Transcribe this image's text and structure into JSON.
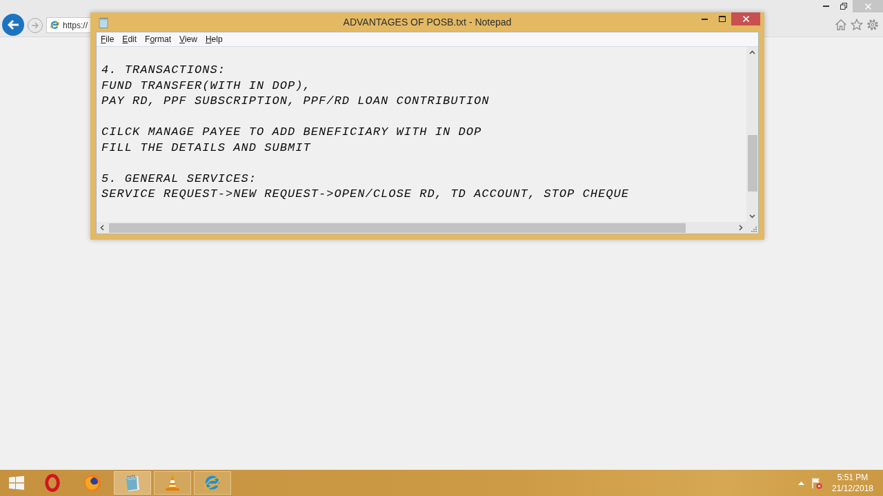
{
  "browser": {
    "address": "https://"
  },
  "notepad": {
    "title": "ADVANTAGES OF POSB.txt - Notepad",
    "menu": [
      {
        "access_key": "F",
        "text_after": "ile"
      },
      {
        "access_key": "E",
        "text_after": "dit"
      },
      {
        "text_before": "F",
        "access_key": "o",
        "text_after": "rmat"
      },
      {
        "access_key": "V",
        "text_after": "iew"
      },
      {
        "access_key": "H",
        "text_after": "elp"
      }
    ],
    "paragraphs": [
      [
        "4. TRANSACTIONS:",
        "FUND TRANSFER(WITH IN DOP),",
        "PAY RD, PPF SUBSCRIPTION, PPF/RD LOAN CONTRIBUTION"
      ],
      [
        "CILCK MANAGE PAYEE TO ADD BENEFICIARY WITH IN DOP",
        "FILL THE DETAILS AND SUBMIT"
      ],
      [
        "5. GENERAL SERVICES:",
        "SERVICE REQUEST->NEW REQUEST->OPEN/CLOSE RD, TD ACCOUNT, STOP CHEQUE"
      ]
    ]
  },
  "taskbar": {
    "apps": [
      {
        "kind": "ring",
        "running": false,
        "active": false
      },
      {
        "kind": "globe",
        "running": false,
        "active": false
      },
      {
        "kind": "notepad",
        "running": true,
        "active": true
      },
      {
        "kind": "cone",
        "running": true,
        "active": false
      },
      {
        "kind": "orbit",
        "running": true,
        "active": false
      }
    ],
    "clock": {
      "time": "5:51 PM",
      "date": "21/12/2018"
    }
  }
}
